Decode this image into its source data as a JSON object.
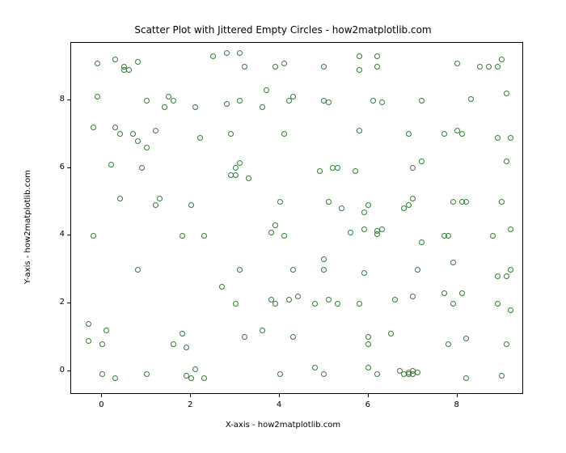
{
  "chart_data": {
    "type": "scatter",
    "title": "Scatter Plot with Jittered Empty Circles - how2matplotlib.com",
    "xlabel": "X-axis - how2matplotlib.com",
    "ylabel": "Y-axis - how2matplotlib.com",
    "xlim": [
      -0.7,
      9.5
    ],
    "ylim": [
      -0.7,
      9.7
    ],
    "xticks": [
      0,
      2,
      4,
      6,
      8
    ],
    "yticks": [
      0,
      2,
      4,
      6,
      8
    ],
    "marker": "empty-circle",
    "color": "#2e7d32",
    "points": [
      [
        -0.3,
        0.9
      ],
      [
        -0.3,
        1.4
      ],
      [
        -0.2,
        4.0
      ],
      [
        -0.2,
        7.2
      ],
      [
        -0.1,
        8.1
      ],
      [
        -0.1,
        9.1
      ],
      [
        0.0,
        -0.1
      ],
      [
        0.0,
        0.8
      ],
      [
        0.1,
        1.2
      ],
      [
        0.2,
        6.1
      ],
      [
        0.3,
        -0.2
      ],
      [
        0.3,
        7.2
      ],
      [
        0.3,
        9.2
      ],
      [
        0.4,
        5.1
      ],
      [
        0.4,
        7.0
      ],
      [
        0.5,
        8.9
      ],
      [
        0.5,
        9.0
      ],
      [
        0.6,
        8.9
      ],
      [
        0.7,
        7.0
      ],
      [
        0.8,
        3.0
      ],
      [
        0.8,
        6.8
      ],
      [
        0.8,
        9.15
      ],
      [
        0.9,
        6.0
      ],
      [
        1.0,
        -0.1
      ],
      [
        1.0,
        6.6
      ],
      [
        1.0,
        8.0
      ],
      [
        1.2,
        4.9
      ],
      [
        1.2,
        7.1
      ],
      [
        1.3,
        5.1
      ],
      [
        1.4,
        7.8
      ],
      [
        1.5,
        8.1
      ],
      [
        1.6,
        0.8
      ],
      [
        1.6,
        8.0
      ],
      [
        1.8,
        1.1
      ],
      [
        1.8,
        4.0
      ],
      [
        1.9,
        -0.15
      ],
      [
        1.9,
        0.7
      ],
      [
        2.0,
        -0.2
      ],
      [
        2.0,
        4.9
      ],
      [
        2.1,
        0.05
      ],
      [
        2.1,
        7.8
      ],
      [
        2.2,
        6.9
      ],
      [
        2.3,
        -0.2
      ],
      [
        2.3,
        4.0
      ],
      [
        2.5,
        9.3
      ],
      [
        2.7,
        2.5
      ],
      [
        2.8,
        7.9
      ],
      [
        2.8,
        9.4
      ],
      [
        2.9,
        5.8
      ],
      [
        2.9,
        7.0
      ],
      [
        3.0,
        2.0
      ],
      [
        3.0,
        5.8
      ],
      [
        3.0,
        6.0
      ],
      [
        3.1,
        3.0
      ],
      [
        3.1,
        6.15
      ],
      [
        3.1,
        8.0
      ],
      [
        3.1,
        9.4
      ],
      [
        3.2,
        1.0
      ],
      [
        3.2,
        9.0
      ],
      [
        3.3,
        5.7
      ],
      [
        3.6,
        1.2
      ],
      [
        3.6,
        7.8
      ],
      [
        3.7,
        8.3
      ],
      [
        3.8,
        2.1
      ],
      [
        3.8,
        4.1
      ],
      [
        3.9,
        2.0
      ],
      [
        3.9,
        4.3
      ],
      [
        3.9,
        9.0
      ],
      [
        4.0,
        -0.1
      ],
      [
        4.0,
        5.0
      ],
      [
        4.1,
        4.0
      ],
      [
        4.1,
        7.0
      ],
      [
        4.1,
        9.1
      ],
      [
        4.2,
        2.1
      ],
      [
        4.2,
        8.0
      ],
      [
        4.3,
        1.0
      ],
      [
        4.3,
        3.0
      ],
      [
        4.3,
        8.1
      ],
      [
        4.4,
        2.2
      ],
      [
        4.8,
        0.1
      ],
      [
        4.8,
        2.0
      ],
      [
        4.9,
        5.9
      ],
      [
        5.0,
        -0.1
      ],
      [
        5.0,
        3.0
      ],
      [
        5.0,
        3.3
      ],
      [
        5.0,
        8.0
      ],
      [
        5.0,
        9.0
      ],
      [
        5.1,
        2.1
      ],
      [
        5.1,
        5.0
      ],
      [
        5.1,
        7.95
      ],
      [
        5.2,
        6.0
      ],
      [
        5.3,
        2.0
      ],
      [
        5.3,
        6.0
      ],
      [
        5.4,
        4.8
      ],
      [
        5.6,
        4.1
      ],
      [
        5.7,
        5.9
      ],
      [
        5.8,
        2.0
      ],
      [
        5.8,
        7.1
      ],
      [
        5.8,
        8.9
      ],
      [
        5.8,
        9.3
      ],
      [
        5.9,
        2.9
      ],
      [
        5.9,
        4.2
      ],
      [
        5.9,
        4.7
      ],
      [
        6.0,
        0.1
      ],
      [
        6.0,
        0.8
      ],
      [
        6.0,
        1.0
      ],
      [
        6.0,
        4.9
      ],
      [
        6.1,
        8.0
      ],
      [
        6.2,
        -0.1
      ],
      [
        6.2,
        4.05
      ],
      [
        6.2,
        4.15
      ],
      [
        6.2,
        9.0
      ],
      [
        6.2,
        9.3
      ],
      [
        6.3,
        4.2
      ],
      [
        6.3,
        7.95
      ],
      [
        6.5,
        1.1
      ],
      [
        6.6,
        2.1
      ],
      [
        6.7,
        0.0
      ],
      [
        6.8,
        -0.1
      ],
      [
        6.8,
        4.8
      ],
      [
        6.9,
        -0.05
      ],
      [
        6.9,
        -0.1
      ],
      [
        6.9,
        4.9
      ],
      [
        6.9,
        7.0
      ],
      [
        7.0,
        -0.1
      ],
      [
        7.0,
        0.0
      ],
      [
        7.0,
        2.2
      ],
      [
        7.0,
        5.1
      ],
      [
        7.0,
        6.0
      ],
      [
        7.1,
        -0.05
      ],
      [
        7.1,
        3.0
      ],
      [
        7.2,
        3.8
      ],
      [
        7.2,
        6.2
      ],
      [
        7.2,
        8.0
      ],
      [
        7.7,
        2.3
      ],
      [
        7.7,
        4.0
      ],
      [
        7.7,
        7.0
      ],
      [
        7.8,
        0.8
      ],
      [
        7.8,
        4.0
      ],
      [
        7.9,
        2.0
      ],
      [
        7.9,
        3.2
      ],
      [
        7.9,
        5.0
      ],
      [
        8.0,
        7.1
      ],
      [
        8.0,
        9.1
      ],
      [
        8.1,
        2.3
      ],
      [
        8.1,
        5.0
      ],
      [
        8.1,
        7.0
      ],
      [
        8.2,
        -0.2
      ],
      [
        8.2,
        0.95
      ],
      [
        8.2,
        5.0
      ],
      [
        8.3,
        8.05
      ],
      [
        8.5,
        9.0
      ],
      [
        8.7,
        9.0
      ],
      [
        8.8,
        4.0
      ],
      [
        8.9,
        2.0
      ],
      [
        8.9,
        2.8
      ],
      [
        8.9,
        6.9
      ],
      [
        8.9,
        9.0
      ],
      [
        9.0,
        -0.15
      ],
      [
        9.0,
        5.0
      ],
      [
        9.0,
        9.2
      ],
      [
        9.1,
        0.8
      ],
      [
        9.1,
        2.8
      ],
      [
        9.1,
        6.2
      ],
      [
        9.1,
        8.2
      ],
      [
        9.2,
        1.8
      ],
      [
        9.2,
        3.0
      ],
      [
        9.2,
        4.2
      ],
      [
        9.2,
        6.9
      ]
    ]
  }
}
